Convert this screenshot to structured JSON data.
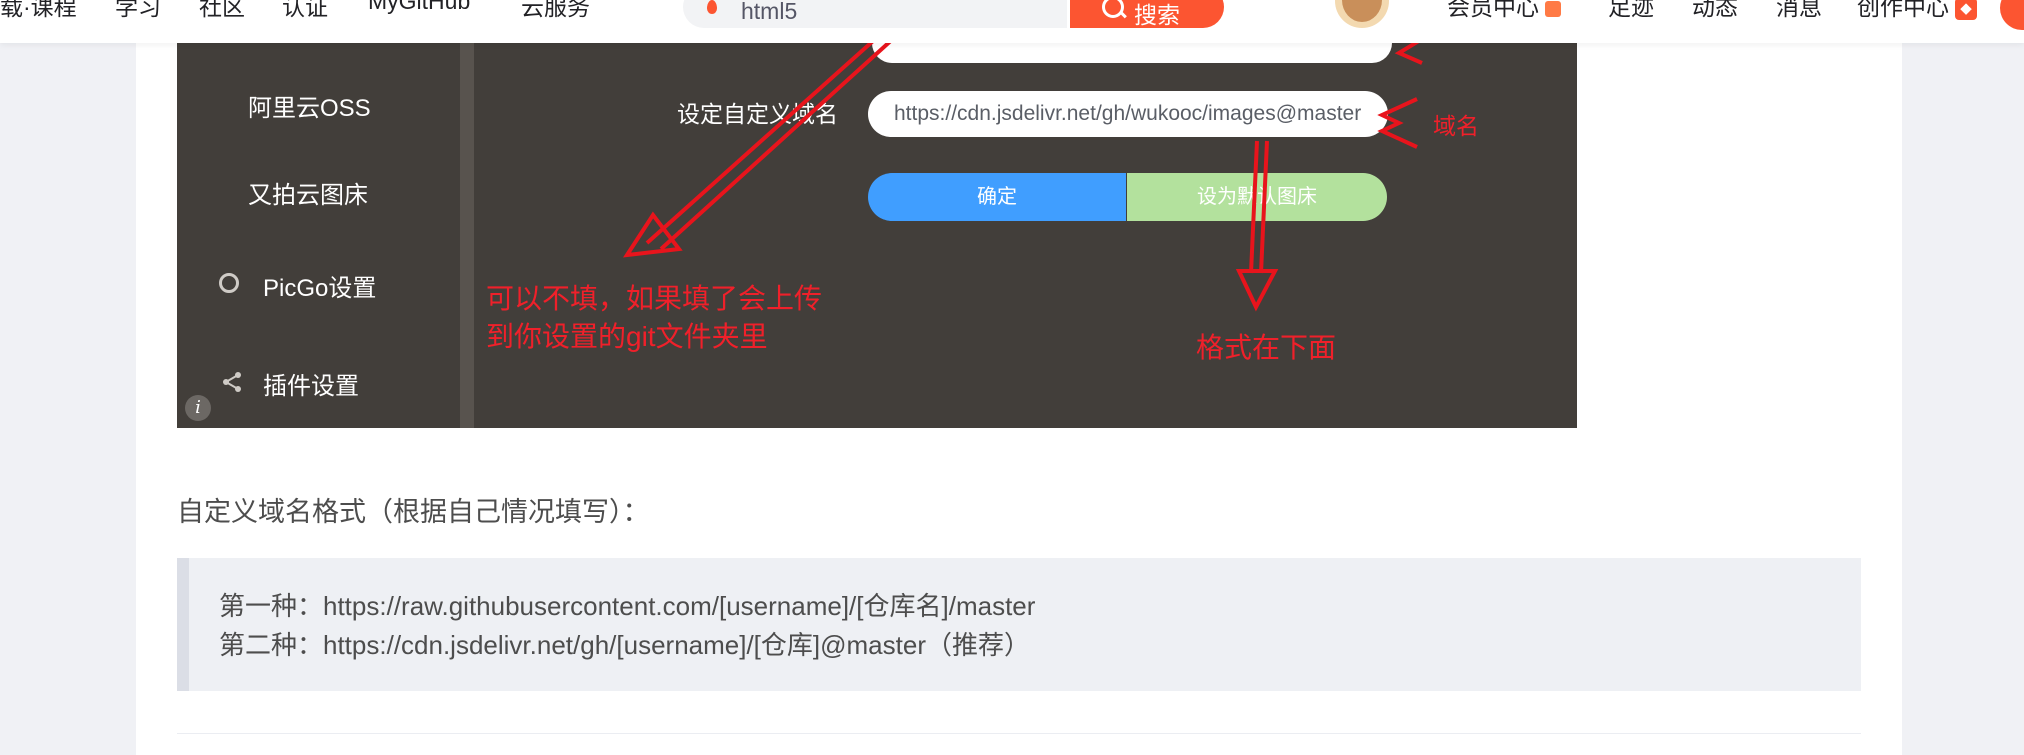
{
  "nav": {
    "items": [
      "载·课程",
      "学习",
      "社区",
      "认证",
      "MyGitHub",
      "云服务"
    ],
    "right_items": [
      "会员中心",
      "足迹",
      "动态",
      "消息",
      "创作中心"
    ],
    "hot_badge": "💗"
  },
  "search": {
    "value": "html5",
    "button_label": "搜索"
  },
  "screenshot": {
    "sidebar": [
      "阿里云OSS",
      "又拍云图床",
      "PicGo设置",
      "插件设置"
    ],
    "domain_label": "设定自定义域名",
    "domain_value": "https://cdn.jsdelivr.net/gh/wukooc/images@master",
    "confirm_button": "确定",
    "default_button": "设为默认图床",
    "annotations": {
      "domain": "域名",
      "optional": [
        "可以不填，如果填了会上传",
        "到你设置的git文件夹里"
      ],
      "format_below": "格式在下面"
    },
    "info_icon": "i"
  },
  "article": {
    "caption": "自定义域名格式（根据自己情况填写）：",
    "code_lines": [
      "第一种：https://raw.githubusercontent.com/[username]/[仓库名]/master",
      "第二种：https://cdn.jsdelivr.net/gh/[username]/[仓库]@master（推荐）"
    ]
  },
  "colors": {
    "accent": "#fc5531",
    "annotation_red": "#f0202a",
    "confirm_blue": "#409eff",
    "default_green": "#b3e19d",
    "picgo_bg": "#423e3a"
  }
}
